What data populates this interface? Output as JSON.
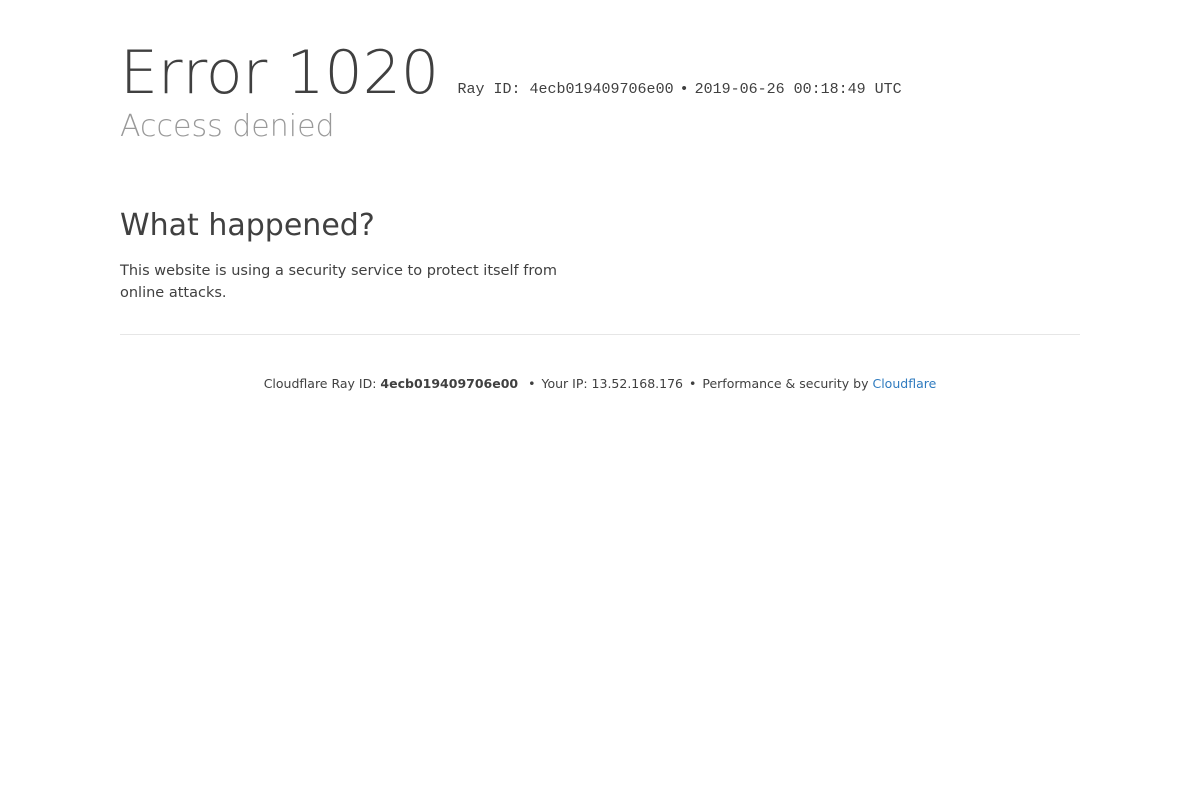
{
  "error": {
    "title": "Error 1020",
    "ray_label": "Ray ID: 4ecb019409706e00",
    "separator": "•",
    "timestamp": "2019-06-26 00:18:49 UTC",
    "subtitle": "Access denied"
  },
  "section": {
    "heading": "What happened?",
    "description": "This website is using a security service to protect itself from online attacks."
  },
  "footer": {
    "ray_label": "Cloudflare Ray ID:",
    "ray_id": "4ecb019409706e00",
    "dot": "•",
    "ip_label": "Your IP: 13.52.168.176",
    "perf_label": "Performance & security by",
    "link_text": "Cloudflare"
  },
  "colors": {
    "text": "#404040",
    "muted": "#999999",
    "link": "#2f7bbf",
    "divider": "#e6e6e6"
  }
}
